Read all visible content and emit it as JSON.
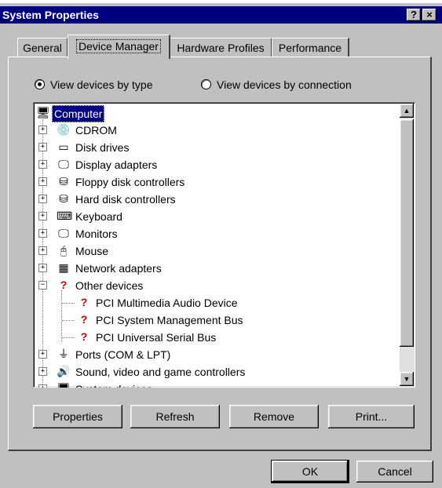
{
  "window": {
    "title": "System Properties",
    "help_button": "?",
    "close_button": "×"
  },
  "tabs": [
    {
      "label": "General"
    },
    {
      "label": "Device Manager"
    },
    {
      "label": "Hardware Profiles"
    },
    {
      "label": "Performance"
    }
  ],
  "view_options": {
    "by_type": "View devices by type",
    "by_connection": "View devices by connection",
    "selected": "by_type"
  },
  "tree": {
    "root": "Computer",
    "items": [
      {
        "label": "CDROM"
      },
      {
        "label": "Disk drives"
      },
      {
        "label": "Display adapters"
      },
      {
        "label": "Floppy disk controllers"
      },
      {
        "label": "Hard disk controllers"
      },
      {
        "label": "Keyboard"
      },
      {
        "label": "Monitors"
      },
      {
        "label": "Mouse"
      },
      {
        "label": "Network adapters"
      },
      {
        "label": "Other devices"
      },
      {
        "label": "PCI Multimedia Audio Device"
      },
      {
        "label": "PCI System Management Bus"
      },
      {
        "label": "PCI Universal Serial Bus"
      },
      {
        "label": "Ports (COM & LPT)"
      },
      {
        "label": "Sound, video and game controllers"
      },
      {
        "label": "System devices"
      }
    ]
  },
  "actions": {
    "properties": "Properties",
    "refresh": "Refresh",
    "remove": "Remove",
    "print": "Print..."
  },
  "dialog": {
    "ok": "OK",
    "cancel": "Cancel"
  }
}
